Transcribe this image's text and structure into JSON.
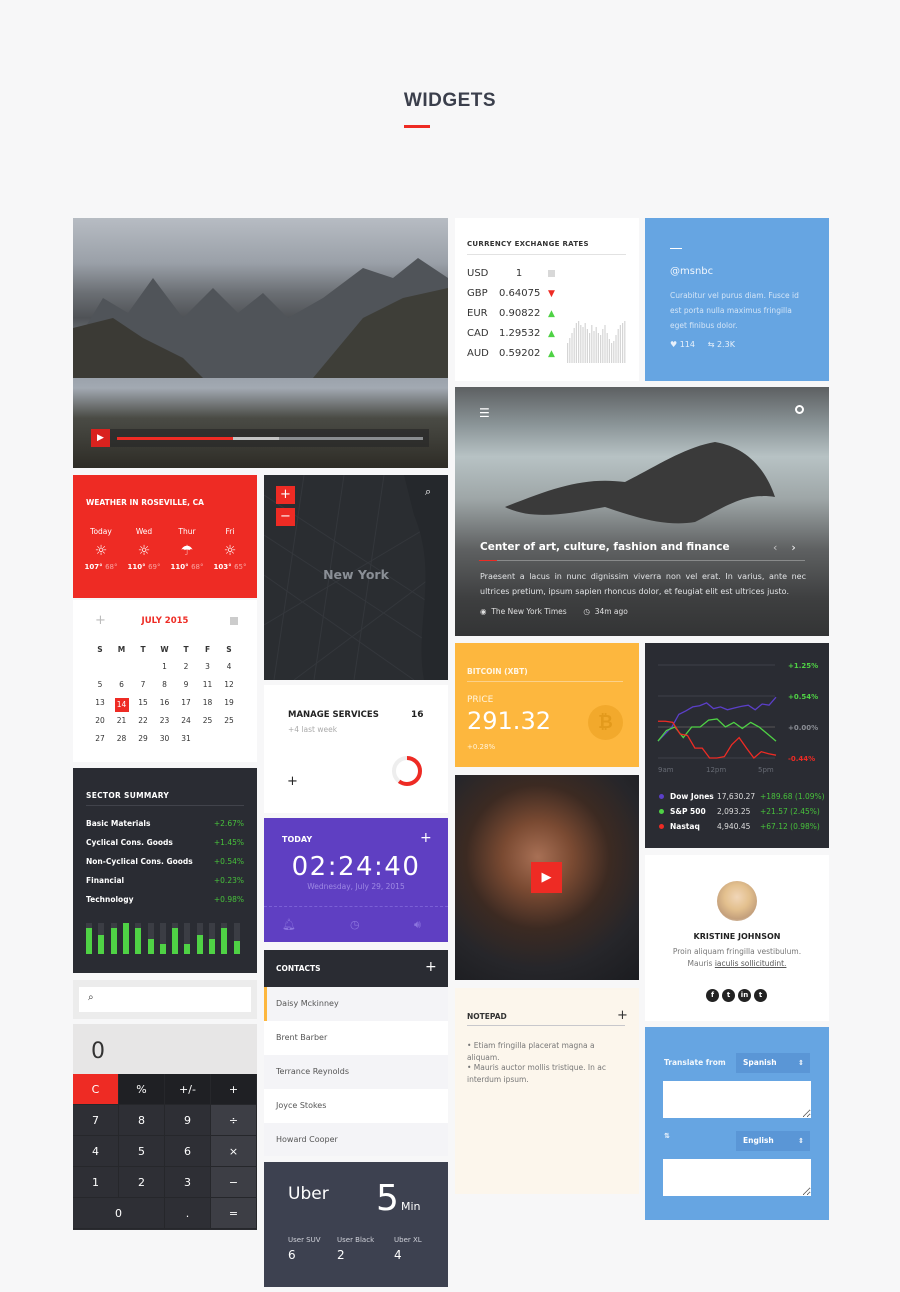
{
  "page": {
    "title": "WIDGETS"
  },
  "video": {
    "progress": 0.38,
    "buffered": 0.53,
    "play_icon": "play-icon"
  },
  "currency": {
    "title": "CURRENCY EXCHANGE RATES",
    "rates": [
      {
        "code": "USD",
        "value": "1",
        "trend": "flat"
      },
      {
        "code": "GBP",
        "value": "0.64075",
        "trend": "down"
      },
      {
        "code": "EUR",
        "value": "0.90822",
        "trend": "up"
      },
      {
        "code": "CAD",
        "value": "1.29532",
        "trend": "up"
      },
      {
        "code": "AUD",
        "value": "0.59202",
        "trend": "up"
      }
    ]
  },
  "twitter": {
    "handle": "@msnbc",
    "text": "Curabitur vel purus diam. Fusce id est porta nulla maximus fringilla eget finibus dolor.",
    "likes": "114",
    "retweets": "2.3K"
  },
  "news": {
    "headline": "Center of art, culture, fashion and finance",
    "body": "Praesent a lacus in nunc dignissim viverra non vel erat. In varius, ante nec ultrices pretium, ipsum sapien rhoncus dolor, et feugiat elit est ultrices justo.",
    "source": "The New York Times",
    "time": "34m ago"
  },
  "weather": {
    "title": "WEATHER IN ROSEVILLE, CA",
    "days": [
      {
        "day": "Today",
        "icon": "sun-icon",
        "high": "107°",
        "low": "68°"
      },
      {
        "day": "Wed",
        "icon": "sun-icon",
        "high": "110°",
        "low": "69°"
      },
      {
        "day": "Thur",
        "icon": "rain-icon",
        "high": "110°",
        "low": "68°"
      },
      {
        "day": "Fri",
        "icon": "sun-icon",
        "high": "103°",
        "low": "65°"
      }
    ]
  },
  "map": {
    "city": "New York",
    "zoom_in": "+",
    "zoom_out": "−"
  },
  "calendar": {
    "month": "JULY 2015",
    "weekdays": [
      "S",
      "M",
      "T",
      "W",
      "T",
      "F",
      "S"
    ],
    "weeks": [
      [
        "",
        "",
        "",
        "1",
        "2",
        "3",
        "4"
      ],
      [
        "5",
        "6",
        "7",
        "8",
        "9",
        "11",
        "12"
      ],
      [
        "13",
        "14",
        "15",
        "16",
        "17",
        "18",
        "19"
      ],
      [
        "20",
        "21",
        "22",
        "23",
        "24",
        "25",
        "25"
      ],
      [
        "27",
        "28",
        "29",
        "30",
        "31",
        "",
        ""
      ]
    ],
    "selected": "14"
  },
  "manage": {
    "title": "MANAGE SERVICES",
    "count": "16",
    "sub": "+4 last week",
    "progress": 0.6
  },
  "clock": {
    "label": "TODAY",
    "time": "02:24:40",
    "date": "Wednesday, July 29, 2015"
  },
  "sector": {
    "title": "SECTOR SUMMARY",
    "rows": [
      {
        "name": "Basic Materials",
        "change": "+2.67%"
      },
      {
        "name": "Cyclical Cons. Goods",
        "change": "+1.45%"
      },
      {
        "name": "Non-Cyclical Cons. Goods",
        "change": "+0.54%"
      },
      {
        "name": "Financial",
        "change": "+0.23%"
      },
      {
        "name": "Technology",
        "change": "+0.98%"
      }
    ],
    "bars": [
      0.85,
      0.62,
      0.85,
      1.0,
      0.85,
      0.5,
      0.32,
      0.85,
      0.32,
      0.62,
      0.5,
      0.85,
      0.43
    ]
  },
  "bitcoin": {
    "title": "BITCOIN (XBT)",
    "price_label": "PRICE",
    "price": "291.32",
    "change": "+0.28%"
  },
  "stocks": {
    "y_labels": [
      "+1.25%",
      "+0.54%",
      "+0.00%",
      "-0.44%"
    ],
    "x_labels": [
      "9am",
      "12pm",
      "5pm"
    ],
    "legend": [
      {
        "name": "Dow Jones",
        "value": "17,630.27",
        "change": "+189.68 (1.09%)",
        "color": "#5b3fc8"
      },
      {
        "name": "S&P 500",
        "value": "2,093.25",
        "change": "+21.57 (2.45%)",
        "color": "#4fd245"
      },
      {
        "name": "Nastaq",
        "value": "4,940.45",
        "change": "+67.12 (0.98%)",
        "color": "#ee2b24"
      }
    ]
  },
  "chart_data": {
    "type": "line",
    "title": "",
    "x": [
      "9am",
      "",
      "",
      "",
      "",
      "",
      "",
      "",
      "",
      "",
      "12pm",
      "",
      "",
      "",
      "",
      "",
      "",
      "",
      "",
      "",
      "5pm"
    ],
    "xlabel": "",
    "ylabel": "",
    "y_ticks": [
      "+1.25%",
      "+0.54%",
      "+0.00%",
      "-0.44%"
    ],
    "series": [
      {
        "name": "Dow Jones",
        "values": [
          -0.2,
          -0.1,
          0.0,
          0.22,
          0.28,
          0.35,
          0.37,
          0.42,
          0.32,
          0.35,
          0.3,
          0.33,
          0.36,
          0.38,
          0.3,
          0.4,
          0.38,
          0.52
        ]
      },
      {
        "name": "S&P 500",
        "values": [
          -0.2,
          -0.05,
          0.0,
          -0.15,
          0.0,
          0.0,
          0.12,
          0.14,
          0.0,
          0.08,
          -0.02,
          0.08,
          0.0,
          -0.1,
          -0.2
        ]
      },
      {
        "name": "Nastaq",
        "values": [
          0.1,
          0.1,
          0.08,
          -0.1,
          -0.12,
          -0.3,
          -0.3,
          -0.44,
          -0.44,
          -0.42,
          -0.25,
          -0.15,
          -0.3,
          -0.44,
          -0.35,
          -0.38,
          -0.4
        ]
      }
    ]
  },
  "profile": {
    "name": "KRISTINE JOHNSON",
    "bio_1": "Proin aliquam fringilla vestibulum.",
    "bio_2": "Mauris",
    "bio_link": "iaculis sollicitudint.",
    "social": [
      "f",
      "t",
      "in",
      "t"
    ]
  },
  "notepad": {
    "title": "NOTEPAD",
    "items": [
      "• Etiam fringilla placerat magna a aliquam.",
      "• Mauris auctor mollis tristique. In ac interdum ipsum."
    ]
  },
  "translate": {
    "from_label": "Translate from",
    "from_lang": "Spanish",
    "swap": "⇅",
    "to_lang": "English"
  },
  "search": {
    "placeholder": ""
  },
  "calculator": {
    "display": "0",
    "keys": [
      [
        "C",
        "%",
        "+/-",
        "+"
      ],
      [
        "7",
        "8",
        "9",
        "÷"
      ],
      [
        "4",
        "5",
        "6",
        "×"
      ],
      [
        "1",
        "2",
        "3",
        "−"
      ],
      [
        "0",
        ".",
        "="
      ]
    ]
  },
  "contacts": {
    "title": "CONTACTS",
    "items": [
      "Daisy Mckinney",
      "Brent Barber",
      "Terrance Reynolds",
      "Joyce Stokes",
      "Howard Cooper"
    ]
  },
  "uber": {
    "brand": "Uber",
    "eta": "5",
    "unit": "Min",
    "options": [
      {
        "name": "User SUV",
        "count": "6"
      },
      {
        "name": "User Black",
        "count": "2"
      },
      {
        "name": "Uber XL",
        "count": "4"
      }
    ]
  }
}
